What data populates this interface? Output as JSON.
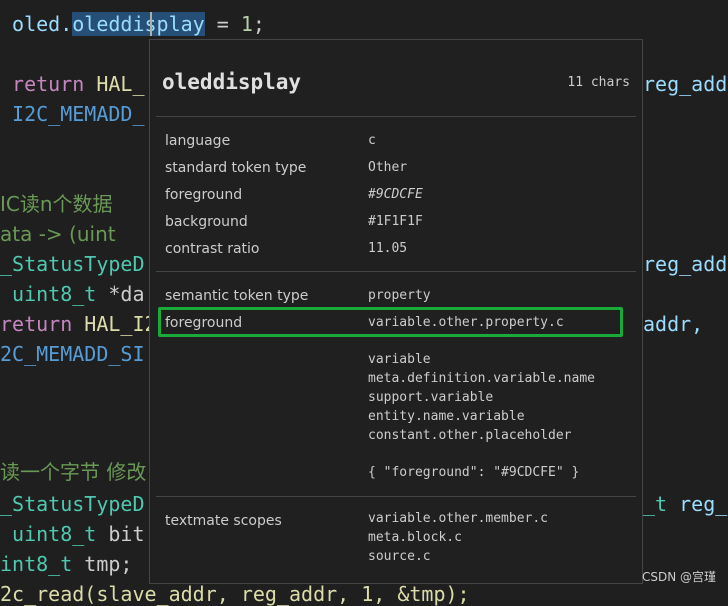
{
  "code_lines": [
    {
      "id": "l1",
      "tokens": [
        {
          "t": " oled.",
          "c": "var"
        },
        {
          "t": "oleddisplay",
          "c": "var hl"
        },
        {
          "t": " = ",
          "c": "plain"
        },
        {
          "t": "1",
          "c": "num"
        },
        {
          "t": ";",
          "c": "plain"
        }
      ]
    },
    {
      "id": "l2",
      "tokens": [
        {
          "t": " return",
          "c": "kw"
        },
        {
          "t": " HAL_",
          "c": "fn"
        }
      ]
    },
    {
      "id": "l3",
      "tokens": [
        {
          "t": " I2C_MEMADD_",
          "c": "macro"
        }
      ]
    },
    {
      "id": "l4",
      "tokens": [
        {
          "t": "IC读n个数据",
          "c": "cmt"
        }
      ]
    },
    {
      "id": "l5",
      "tokens": [
        {
          "t": "ata -> (uint",
          "c": "cmt"
        }
      ]
    },
    {
      "id": "l6",
      "tokens": [
        {
          "t": "_StatusTypeD",
          "c": "type"
        }
      ]
    },
    {
      "id": "l7",
      "tokens": [
        {
          "t": " uint8_t",
          "c": "type"
        },
        {
          "t": " *da",
          "c": "plain"
        }
      ]
    },
    {
      "id": "l8",
      "tokens": [
        {
          "t": "return",
          "c": "kw"
        },
        {
          "t": " HAL_I2",
          "c": "fn"
        }
      ]
    },
    {
      "id": "l9",
      "tokens": [
        {
          "t": "2C_MEMADD_SI",
          "c": "macro"
        }
      ]
    },
    {
      "id": "l10",
      "tokens": [
        {
          "t": "读一个字节 修改",
          "c": "cmt"
        }
      ]
    },
    {
      "id": "l11",
      "tokens": [
        {
          "t": "_StatusTypeD",
          "c": "type"
        }
      ]
    },
    {
      "id": "l12",
      "tokens": [
        {
          "t": " uint8_t",
          "c": "type"
        },
        {
          "t": " bit",
          "c": "plain"
        }
      ]
    },
    {
      "id": "l13",
      "tokens": [
        {
          "t": "int8_t",
          "c": "type"
        },
        {
          "t": " tmp;",
          "c": "plain"
        }
      ]
    },
    {
      "id": "l14",
      "tokens": [
        {
          "t": "2c_read(slave_addr, reg_addr, 1, &tmp);",
          "c": "fn"
        }
      ]
    }
  ],
  "code_right": [
    {
      "id": "r1",
      "tokens": [
        {
          "t": "reg_addr",
          "c": "var"
        }
      ]
    },
    {
      "id": "r2",
      "tokens": [
        {
          "t": "reg_add",
          "c": "var"
        }
      ]
    },
    {
      "id": "r3",
      "tokens": [
        {
          "t": "addr,",
          "c": "var"
        }
      ]
    },
    {
      "id": "r4",
      "tokens": [
        {
          "t": "_t",
          "c": "type"
        },
        {
          "t": " reg_",
          "c": "var"
        }
      ]
    }
  ],
  "hover": {
    "title": "oleddisplay",
    "chars": "11 chars",
    "rows": {
      "language": {
        "label": "language",
        "value": "c"
      },
      "standard_token_type": {
        "label": "standard token type",
        "value": "Other"
      },
      "foreground": {
        "label": "foreground",
        "value": "#9CDCFE"
      },
      "background": {
        "label": "background",
        "value": "#1F1F1F"
      },
      "contrast_ratio": {
        "label": "contrast ratio",
        "value": "11.05"
      },
      "semantic_token_type": {
        "label": "semantic token type",
        "value": "property"
      },
      "semantic_foreground": {
        "label": "foreground",
        "value": "variable.other.property.c"
      }
    },
    "fallback_scopes": [
      "variable",
      "meta.definition.variable.name",
      "support.variable",
      "entity.name.variable",
      "constant.other.placeholder"
    ],
    "theme_rule": "{ \"foreground\": \"#9CDCFE\" }",
    "textmate": {
      "label": "textmate scopes",
      "scopes": [
        "variable.other.member.c",
        "meta.block.c",
        "source.c"
      ]
    }
  },
  "watermark": "CSDN @宫瑾",
  "colors": {
    "editor_bg": "#1F1F1F",
    "highlight_box": "#1AAA3A",
    "variable": "#9CDCFE"
  }
}
